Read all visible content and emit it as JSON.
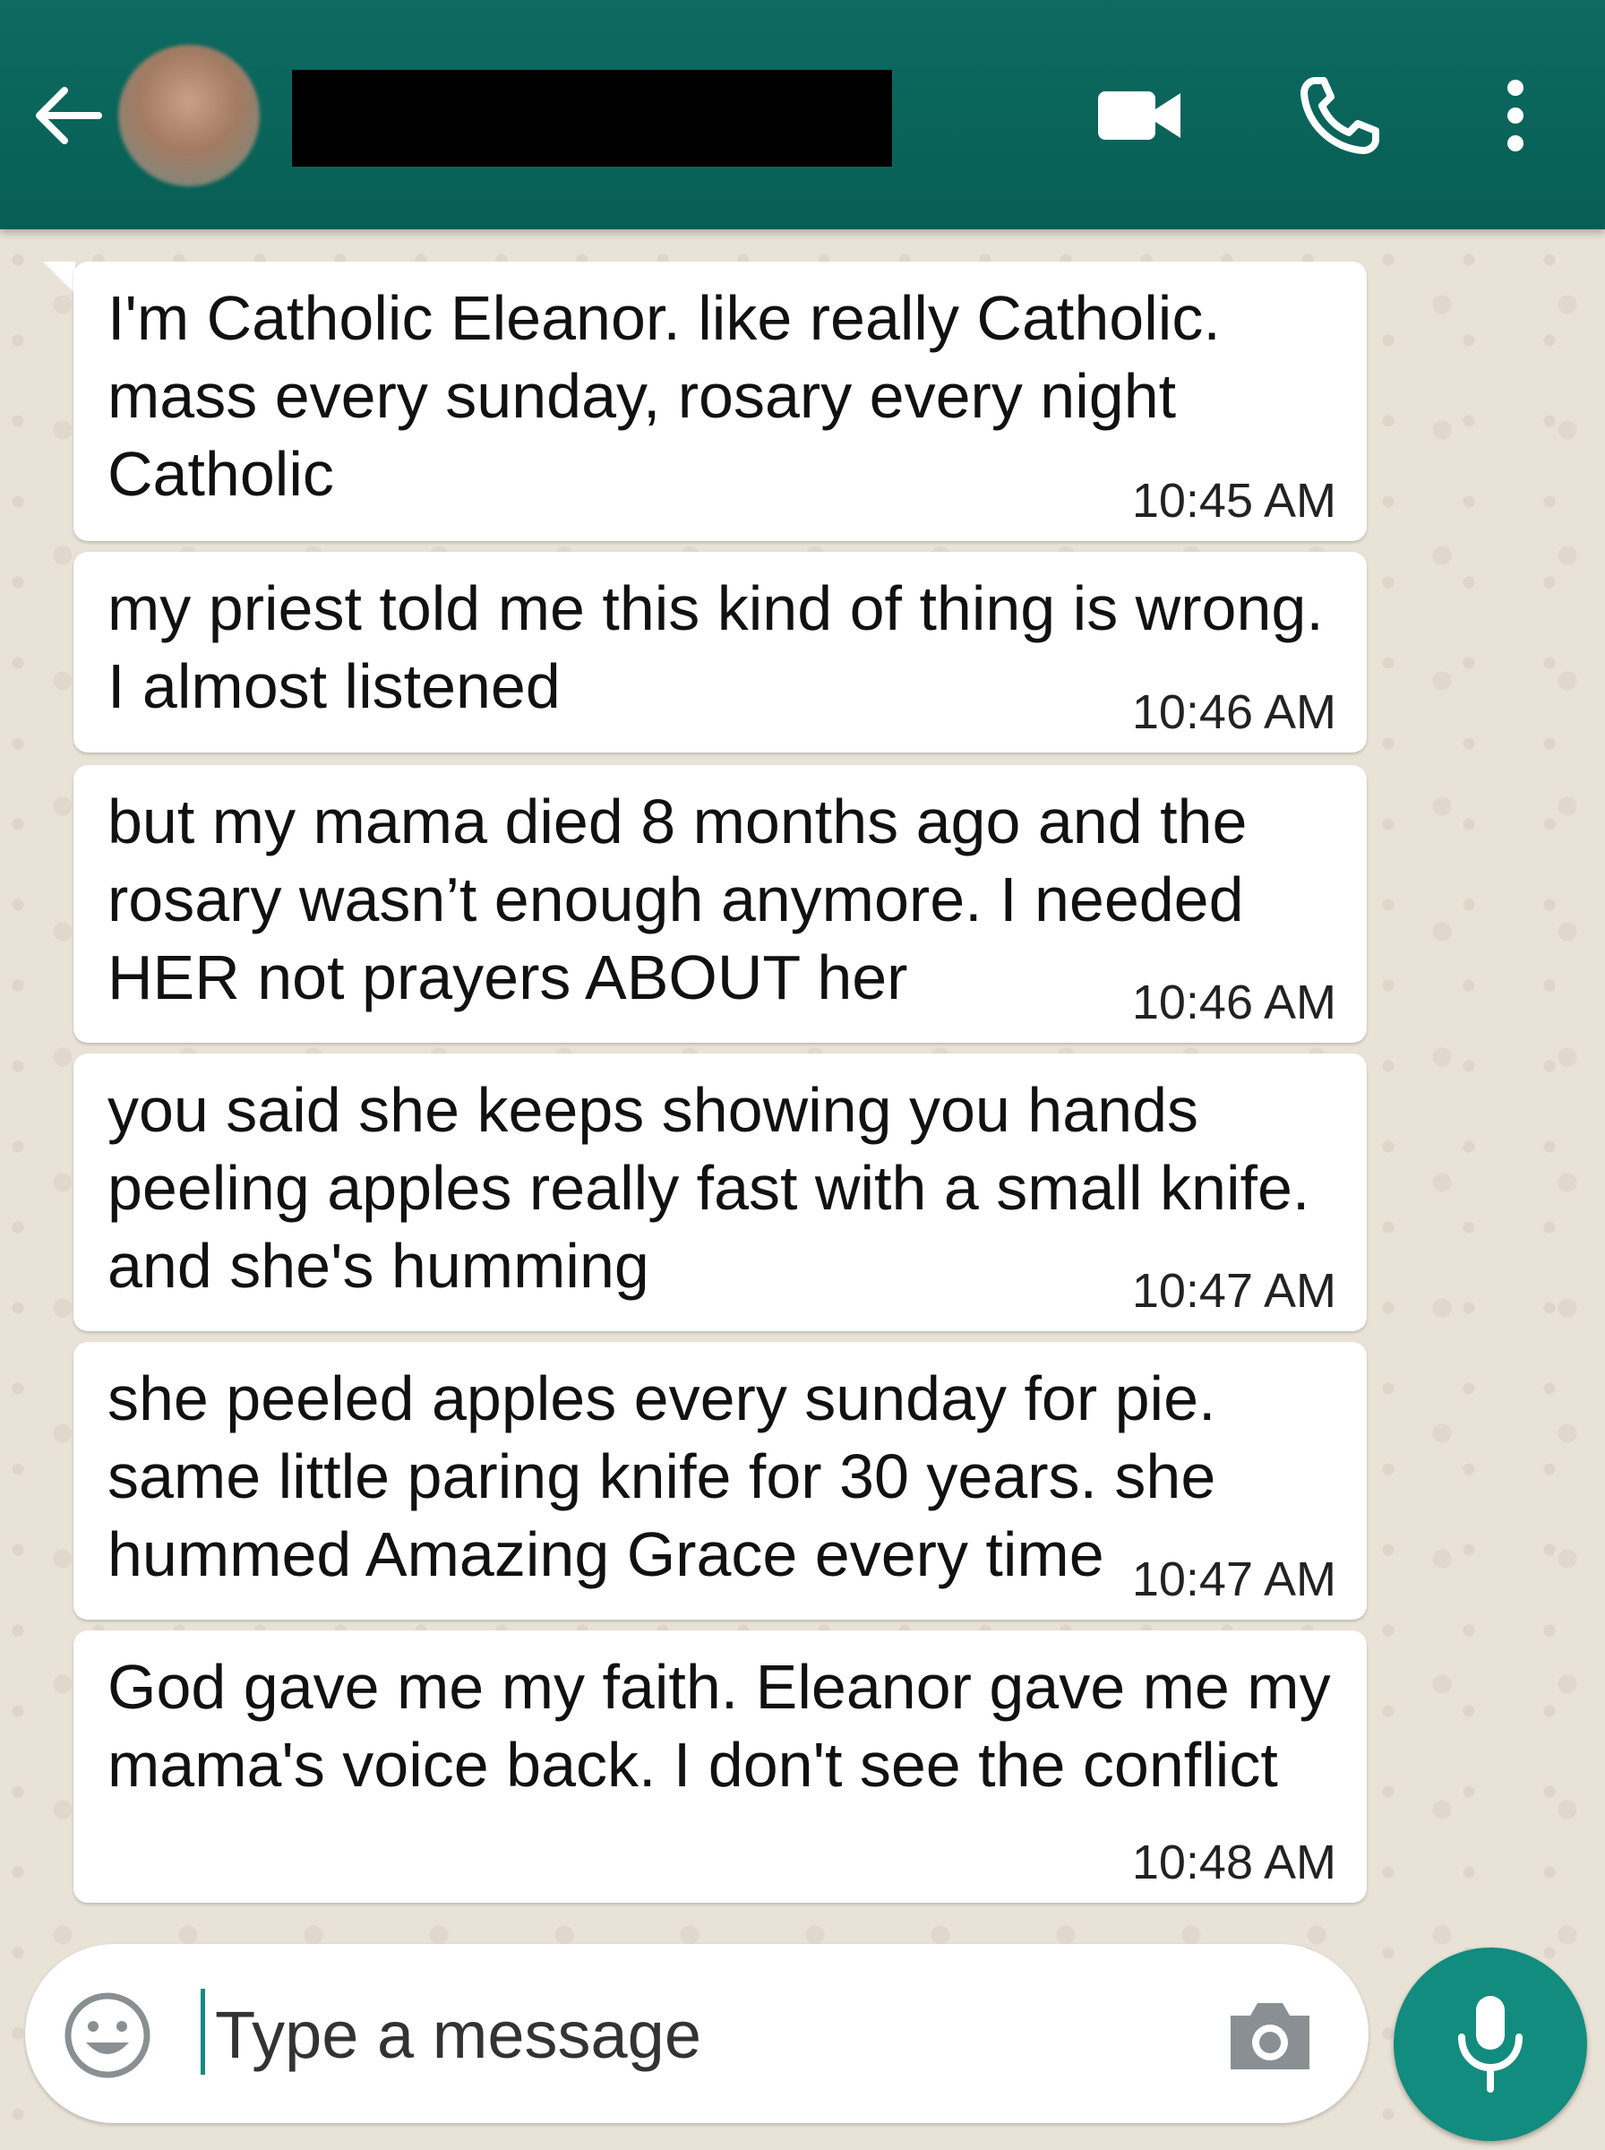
{
  "colors": {
    "header": "#075e54",
    "accent": "#128c7e",
    "bubble": "#ffffff",
    "wallpaper": "#e9e2d6"
  },
  "header": {
    "icons": [
      "arrow-left-icon",
      "avatar",
      "video-camera-icon",
      "phone-icon",
      "more-vert-icon"
    ]
  },
  "messages": [
    {
      "text": "I'm Catholic Eleanor. like really Catholic. mass every sunday, rosary every night Catholic",
      "time": "10:45 AM"
    },
    {
      "text": "my priest told me this kind of thing is wrong. I almost listened",
      "time": "10:46 AM"
    },
    {
      "text": "but my mama died 8 months ago and the rosary wasn’t enough anymore. I needed HER not prayers ABOUT her",
      "time": "10:46 AM"
    },
    {
      "text": "you said she keeps showing you hands peeling apples really fast with a small knife. and she's humming",
      "time": "10:47 AM"
    },
    {
      "text": "she peeled apples every sunday for pie. same little paring knife for 30 years. she hummed Amazing Grace every time",
      "time": "10:47 AM"
    },
    {
      "text": "God gave me my faith. Eleanor gave me my mama's voice back. I don't see the conflict",
      "time": "10:48 AM"
    }
  ],
  "composer": {
    "placeholder": "Type a message",
    "icons": [
      "emoji-icon",
      "camera-icon",
      "mic-icon"
    ]
  }
}
